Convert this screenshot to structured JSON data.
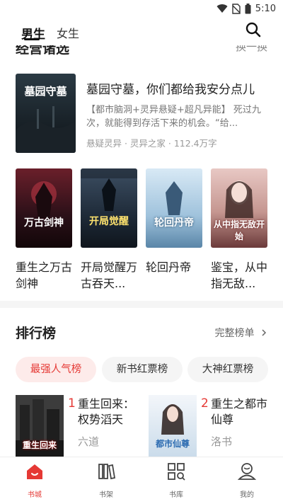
{
  "status_bar": {
    "time": "5:10"
  },
  "header": {
    "tabs": [
      {
        "label": "男生",
        "active": true
      },
      {
        "label": "女生",
        "active": false
      }
    ]
  },
  "clipped_section": {
    "title": "经营诸选",
    "action": "换一换"
  },
  "featured": {
    "title": "墓园守墓，你们都给我安分点儿",
    "description": "【都市脑洞+灵异悬疑+超凡异能】 死过九次，就能得到存活下来的机会。“给...",
    "meta": "悬疑灵异 · 灵异之家 · 112.4万字",
    "cover_text": "墓园守墓"
  },
  "books": [
    {
      "title": "重生之万古剑神",
      "cover_text": "万古剑神"
    },
    {
      "title": "开局觉醒万古吞天...",
      "cover_text": "开局觉醒"
    },
    {
      "title": "轮回丹帝",
      "cover_text": "轮回丹帝"
    },
    {
      "title": "鉴宝，从中指无敌...",
      "cover_text": "从中指无敌开始"
    }
  ],
  "ranking": {
    "title": "排行榜",
    "more": "完整榜单",
    "chips": [
      "最强人气榜",
      "新书红票榜",
      "大神红票榜"
    ],
    "items": [
      {
        "num": "1",
        "title": "重生回来：权势滔天",
        "author": "六道",
        "cover_text": "重生回来"
      },
      {
        "num": "2",
        "title": "重生之都市仙尊",
        "author": "洛书",
        "cover_text": "都市仙尊"
      }
    ]
  },
  "bottom_nav": [
    {
      "label": "书城",
      "active": true
    },
    {
      "label": "书架",
      "active": false
    },
    {
      "label": "书库",
      "active": false
    },
    {
      "label": "我的",
      "active": false
    }
  ],
  "colors": {
    "accent": "#e53935",
    "chip_active_bg": "#fdebea"
  }
}
